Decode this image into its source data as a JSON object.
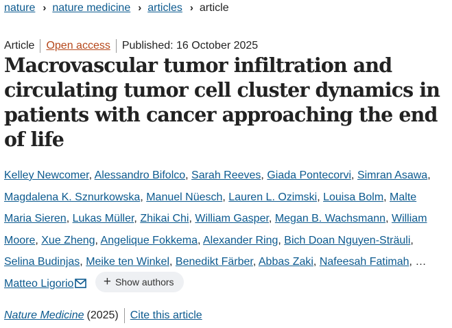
{
  "breadcrumb": {
    "items": [
      "nature",
      "nature medicine",
      "articles"
    ],
    "current": "article"
  },
  "meta": {
    "type": "Article",
    "open_access": "Open access",
    "published": "Published: 16 October 2025"
  },
  "title": "Macrovascular tumor infiltration and circulating tumor cell cluster dynamics in patients with cancer approaching the end of life",
  "authors": [
    "Kelley Newcomer",
    "Alessandro Bifolco",
    "Sarah Reeves",
    "Giada Pontecorvi",
    "Simran Asawa",
    "Magdalena K. Sznurkowska",
    "Manuel Nüesch",
    "Lauren L. Ozimski",
    "Louisa Bolm",
    "Malte Maria Sieren",
    "Lukas Müller",
    "Zhikai Chi",
    "William Gasper",
    "Megan B. Wachsmann",
    "William Moore",
    "Xue Zheng",
    "Angelique Fokkema",
    "Alexander Ring",
    "Bich Doan Nguyen-Sträuli",
    "Selina Budinjas",
    "Meike ten Winkel",
    "Benedikt Färber",
    "Abbas Zaki",
    "Nafeesah Fatimah"
  ],
  "ellipsis": "…",
  "last_author": "Matteo Ligorio",
  "show_authors_label": "Show authors",
  "mail_icon": "envelope-icon",
  "citation": {
    "journal": "Nature Medicine",
    "year": "(2025)",
    "cite_label": "Cite this article"
  }
}
